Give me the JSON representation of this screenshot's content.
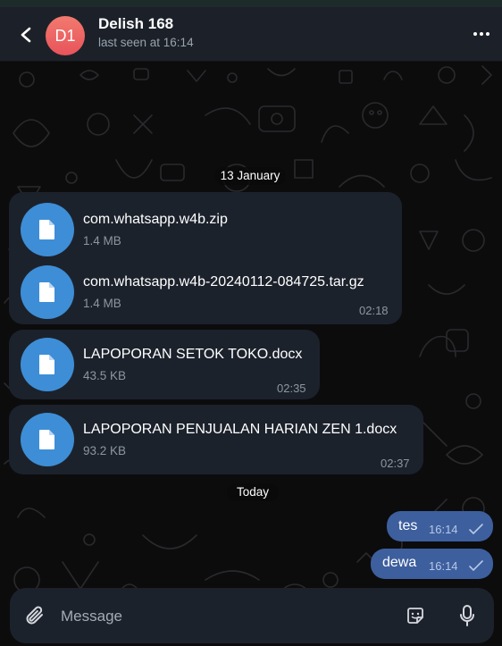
{
  "header": {
    "back_icon": "chevron-left-icon",
    "avatar_initials": "D1",
    "title": "Delish 168",
    "status": "last seen at 16:14",
    "more_icon": "more-horizontal-icon"
  },
  "chat": {
    "date_separators": [
      "13 January",
      "Today"
    ],
    "file_messages": [
      {
        "files": [
          {
            "name": "com.whatsapp.w4b.zip",
            "size": "1.4 MB"
          },
          {
            "name": "com.whatsapp.w4b-20240112-084725.tar.gz",
            "size": "1.4 MB"
          }
        ],
        "time": "02:18"
      },
      {
        "files": [
          {
            "name": "LAPOPORAN SETOK TOKO.docx",
            "size": "43.5 KB"
          }
        ],
        "time": "02:35"
      },
      {
        "files": [
          {
            "name": "LAPOPORAN PENJUALAN HARIAN ZEN 1.docx",
            "size": "93.2 KB"
          }
        ],
        "time": "02:37"
      }
    ],
    "outgoing_messages": [
      {
        "text": "tes",
        "time": "16:14",
        "status": "read"
      },
      {
        "text": "dewa",
        "time": "16:14",
        "status": "read"
      }
    ]
  },
  "composer": {
    "placeholder": "Message",
    "attach_icon": "paperclip-icon",
    "emoji_icon": "sticker-icon",
    "mic_icon": "microphone-icon"
  },
  "colors": {
    "header_bg": "#1c2129",
    "chat_bg": "#0c0c0d",
    "incoming_bubble": "#1c222c",
    "outgoing_bubble": "#3d5f9e",
    "file_icon": "#3d8ed6",
    "avatar_gradient_top": "#f27a6f",
    "avatar_gradient_bottom": "#e8535a"
  }
}
